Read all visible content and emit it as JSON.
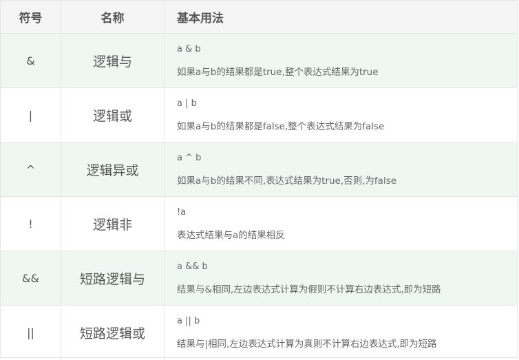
{
  "header": {
    "symbol": "符号",
    "name": "名称",
    "usage": "基本用法"
  },
  "rows": [
    {
      "symbol": "&",
      "name": "逻辑与",
      "expr": "a & b",
      "desc": "如果a与b的结果都是true,整个表达式结果为true"
    },
    {
      "symbol": "|",
      "name": "逻辑或",
      "expr": "a | b",
      "desc": "如果a与b的结果都是false,整个表达式结果为false"
    },
    {
      "symbol": "^",
      "name": "逻辑异或",
      "expr": "a ^ b",
      "desc": "如果a与b的结果不同,表达式结果为true,否则,为false"
    },
    {
      "symbol": "!",
      "name": "逻辑非",
      "expr": "!a",
      "desc": "表达式结果与a的结果相反"
    },
    {
      "symbol": "&&",
      "name": "短路逻辑与",
      "expr": "a && b",
      "desc": "结果与&相同,左边表达式计算为假则不计算右边表达式,即为短路"
    },
    {
      "symbol": "||",
      "name": "短路逻辑或",
      "expr": "a || b",
      "desc": "结果与|相同,左边表达式计算为真则不计算右边表达式,即为短路"
    }
  ],
  "colors": {
    "header_bg": "#f5f5f5",
    "alt_row_bg": "#eef8f1",
    "border": "#e6e6e6",
    "text": "#555555"
  }
}
